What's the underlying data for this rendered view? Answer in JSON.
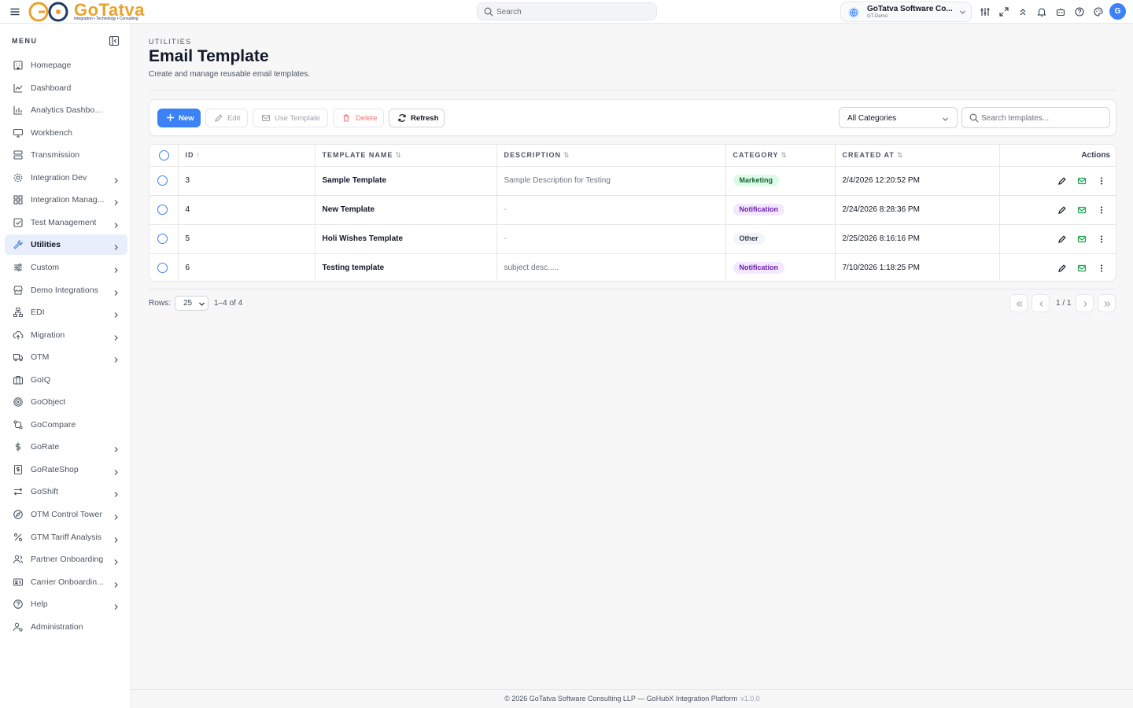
{
  "header": {
    "logo_text": "GoTatva",
    "logo_tagline": "Integration • Technology • Consulting",
    "search_placeholder": "Search",
    "org_name": "GoTatva Software Co...",
    "org_sub": "GT-Demo",
    "avatar_initial": "G"
  },
  "sidebar": {
    "menu_label": "MENU",
    "items": [
      {
        "label": "Homepage",
        "icon": "building-icon",
        "chevron": false
      },
      {
        "label": "Dashboard",
        "icon": "line-chart-icon",
        "chevron": false
      },
      {
        "label": "Analytics Dashboard",
        "icon": "bar-chart-icon",
        "chevron": false
      },
      {
        "label": "Workbench",
        "icon": "monitor-icon",
        "chevron": false
      },
      {
        "label": "Transmission",
        "icon": "server-icon",
        "chevron": false
      },
      {
        "label": "Integration Dev",
        "icon": "gear-icon",
        "chevron": true
      },
      {
        "label": "Integration Manag...",
        "icon": "grid-icon",
        "chevron": true
      },
      {
        "label": "Test Management",
        "icon": "checkbox-icon",
        "chevron": true
      },
      {
        "label": "Utilities",
        "icon": "wrench-icon",
        "chevron": true,
        "active": true
      },
      {
        "label": "Custom",
        "icon": "sliders-icon",
        "chevron": true
      },
      {
        "label": "Demo Integrations",
        "icon": "store-icon",
        "chevron": true
      },
      {
        "label": "EDI",
        "icon": "network-icon",
        "chevron": true
      },
      {
        "label": "Migration",
        "icon": "cloud-upload-icon",
        "chevron": true
      },
      {
        "label": "OTM",
        "icon": "truck-icon",
        "chevron": true
      },
      {
        "label": "GoIQ",
        "icon": "briefcase-icon",
        "chevron": false
      },
      {
        "label": "GoObject",
        "icon": "target-icon",
        "chevron": false
      },
      {
        "label": "GoCompare",
        "icon": "git-compare-icon",
        "chevron": false
      },
      {
        "label": "GoRate",
        "icon": "dollar-icon",
        "chevron": true
      },
      {
        "label": "GoRateShop",
        "icon": "receipt-icon",
        "chevron": true
      },
      {
        "label": "GoShift",
        "icon": "arrows-swap-icon",
        "chevron": true
      },
      {
        "label": "OTM Control Tower",
        "icon": "compass-icon",
        "chevron": true
      },
      {
        "label": "GTM Tariff Analysis",
        "icon": "percent-icon",
        "chevron": true
      },
      {
        "label": "Partner Onboarding",
        "icon": "users-icon",
        "chevron": true
      },
      {
        "label": "Carrier Onboardin...",
        "icon": "id-card-icon",
        "chevron": true
      },
      {
        "label": "Help",
        "icon": "help-circle-icon",
        "chevron": true
      },
      {
        "label": "Administration",
        "icon": "user-gear-icon",
        "chevron": false
      }
    ]
  },
  "page": {
    "breadcrumb": "UTILITIES",
    "title": "Email Template",
    "subtitle": "Create and manage reusable email templates."
  },
  "toolbar": {
    "new_label": "New",
    "edit_label": "Edit",
    "use_template_label": "Use Template",
    "delete_label": "Delete",
    "refresh_label": "Refresh",
    "category_value": "All Categories",
    "search_placeholder": "Search templates..."
  },
  "table": {
    "columns": {
      "id": "ID",
      "name": "TEMPLATE NAME",
      "description": "DESCRIPTION",
      "category": "CATEGORY",
      "created": "CREATED AT",
      "actions": "Actions"
    },
    "rows": [
      {
        "id": "3",
        "name": "Sample Template",
        "description": "Sample Description for Testing",
        "category": "Marketing",
        "created": "2/4/2026 12:20:52 PM"
      },
      {
        "id": "4",
        "name": "New Template",
        "description": "-",
        "category": "Notification",
        "created": "2/24/2026 8:28:36 PM"
      },
      {
        "id": "5",
        "name": "Holi Wishes Template",
        "description": "-",
        "category": "Other",
        "created": "2/25/2026 8:16:16 PM"
      },
      {
        "id": "6",
        "name": "Testing template",
        "description": "subject desc.....",
        "category": "Notification",
        "created": "7/10/2026 1:18:25 PM"
      }
    ]
  },
  "pagination": {
    "rows_label": "Rows:",
    "rows_value": "25",
    "range": "1–4 of 4",
    "page": "1 / 1"
  },
  "footer": {
    "text": "© 2026 GoTatva Software Consulting LLP — GoHubX Integration Platform",
    "version": "v1.0.0"
  },
  "colors": {
    "primary": "#3b82f6",
    "logo": "#e9a22b",
    "marketing_badge": "#dcfce7",
    "notification_badge": "#f3e8ff",
    "other_badge": "#f3f4f6"
  }
}
